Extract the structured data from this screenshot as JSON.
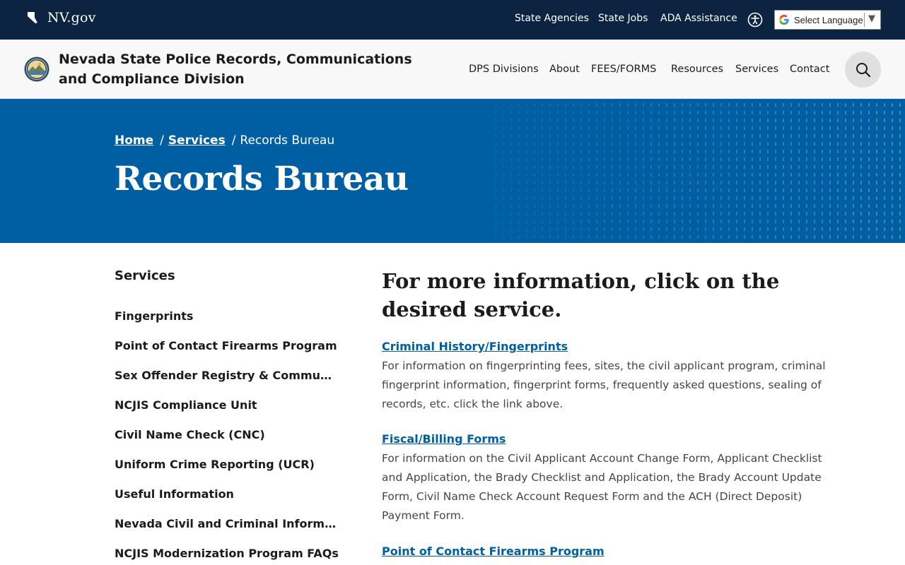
{
  "topbar": {
    "brand": "NV.gov",
    "links": [
      "State Agencies",
      "State Jobs",
      "ADA Assistance"
    ],
    "language_label": "Select Language",
    "icons": {
      "brand": "nevada-state-icon",
      "accessibility": "accessibility-icon",
      "translate": "google-g-icon"
    }
  },
  "header": {
    "title": "Nevada State Police Records, Communications and Compliance Division",
    "nav": [
      "DPS Divisions",
      "About",
      "FEES/FORMS",
      "Resources",
      "Services",
      "Contact"
    ],
    "search_icon": "search-icon"
  },
  "hero": {
    "breadcrumb": [
      "Home",
      "Services",
      "Records Bureau"
    ],
    "title": "Records Bureau"
  },
  "sidebar": {
    "title": "Services",
    "items": [
      "Fingerprints",
      "Point of Contact Firearms Program",
      "Sex Offender Registry & Community Notification",
      "NCJIS Compliance Unit",
      "Civil Name Check (CNC)",
      "Uniform Crime Reporting (UCR)",
      "Useful Information",
      "Nevada Civil and Criminal Information Repository",
      "NCJIS Modernization Program FAQs"
    ]
  },
  "main": {
    "heading": "For more information, click on the desired service.",
    "services": [
      {
        "link": "Criminal History/Fingerprints",
        "description": "For information on fingerprinting fees, sites, the civil applicant program, criminal fingerprint information, fingerprint forms, frequently asked questions, sealing of records, etc. click the link above."
      },
      {
        "link": "Fiscal/Billing Forms",
        "description": "For information on the Civil Applicant Account Change Form, Applicant Checklist and Application, the Brady Checklist and Application, the Brady Account Update Form, Civil Name Check Account Request Form and the ACH (Direct Deposit) Payment Form."
      },
      {
        "link": "Point of Contact Firearms Program",
        "description": ""
      }
    ]
  },
  "colors": {
    "topbar": "#0c2442",
    "hero": "#005ea2",
    "link": "#005ea2"
  }
}
